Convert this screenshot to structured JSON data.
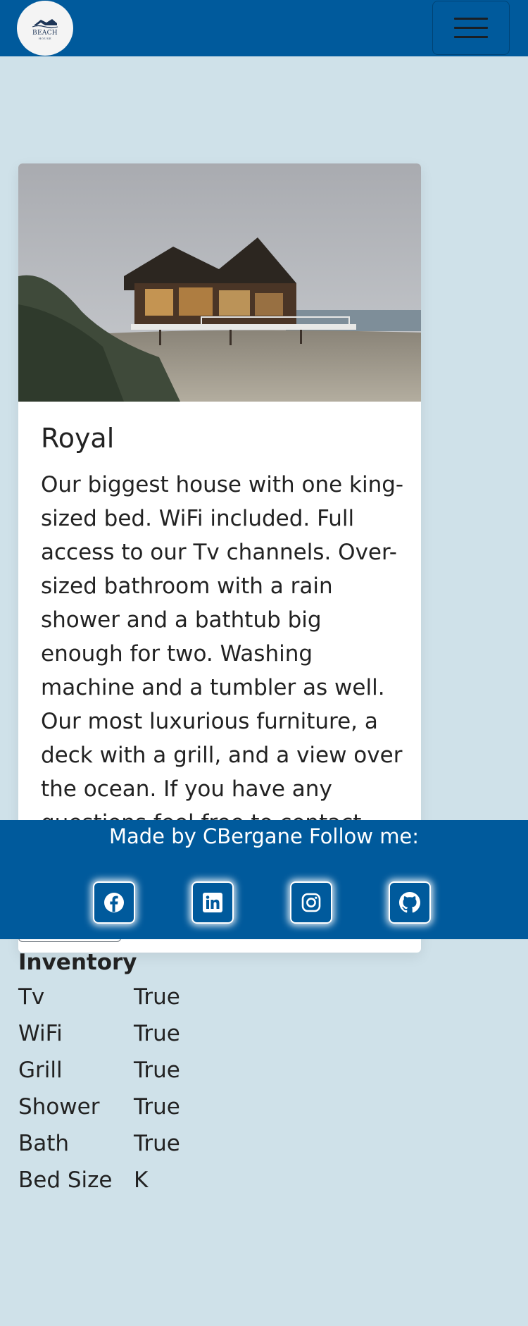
{
  "navbar": {
    "logo": {
      "title": "BEACH",
      "subtitle": "HOUSE",
      "icon": "beach-house-logo"
    },
    "menu_icon": "hamburger-menu-icon",
    "colors": {
      "background": "#005a9c"
    }
  },
  "card": {
    "image_alt": "Beach house on the shore at dusk",
    "title": "Royal",
    "description": "Our biggest house with one king-sized bed. WiFi included. Full access to our Tv channels. Over-sized bathroom with a rain shower and a bathtub big enough for two. Washing machine and a tumbler as well. Our most luxurious furniture, a deck with a grill, and a view over the ocean. If you have any questions feel free to contact"
  },
  "footer": {
    "text": "Made by CBergane Follow me:",
    "social": [
      {
        "name": "facebook",
        "icon": "facebook-icon"
      },
      {
        "name": "linkedin",
        "icon": "linkedin-icon"
      },
      {
        "name": "instagram",
        "icon": "instagram-icon"
      },
      {
        "name": "github",
        "icon": "github-icon"
      }
    ]
  },
  "inventory": {
    "title": "Inventory",
    "rows": [
      {
        "key": "Tv",
        "value": "True"
      },
      {
        "key": "WiFi",
        "value": "True"
      },
      {
        "key": "Grill",
        "value": "True"
      },
      {
        "key": "Shower",
        "value": "True"
      },
      {
        "key": "Bath",
        "value": "True"
      },
      {
        "key": "Bed Size",
        "value": "K"
      }
    ]
  },
  "colors": {
    "page_background": "#cfe1e9",
    "brand_blue": "#005a9c",
    "card_background": "#ffffff"
  }
}
